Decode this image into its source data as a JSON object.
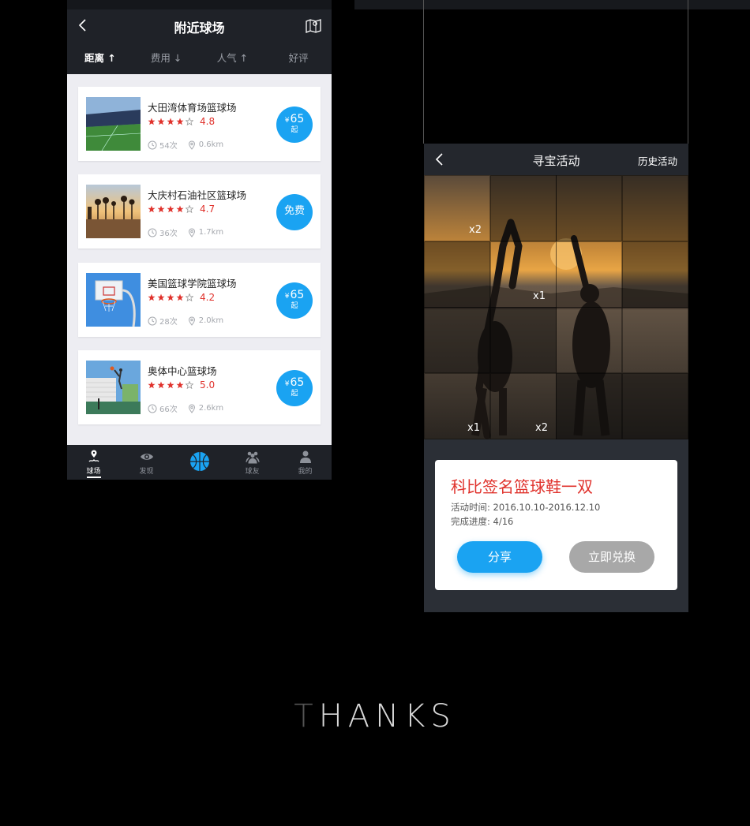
{
  "left_screen": {
    "title": "附近球场",
    "sort_tabs": [
      {
        "label": "距离 ↑",
        "active": true
      },
      {
        "label": "费用 ↓",
        "active": false
      },
      {
        "label": "人气 ↑",
        "active": false
      },
      {
        "label": "好评",
        "active": false
      }
    ],
    "courts": [
      {
        "name": "大田湾体育场篮球场",
        "score": "4.8",
        "stars": 4,
        "visits": "54次",
        "distance": "0.6km",
        "price_prefix": "¥",
        "price": "65",
        "price_suffix": "起",
        "free": false
      },
      {
        "name": "大庆村石油社区篮球场",
        "score": "4.7",
        "stars": 4,
        "visits": "36次",
        "distance": "1.7km",
        "price_label": "免费",
        "free": true
      },
      {
        "name": "美国篮球学院篮球场",
        "score": "4.2",
        "stars": 4,
        "visits": "28次",
        "distance": "2.0km",
        "price_prefix": "¥",
        "price": "65",
        "price_suffix": "起",
        "free": false
      },
      {
        "name": "奥体中心篮球场",
        "score": "5.0",
        "stars": 4,
        "visits": "66次",
        "distance": "2.6km",
        "price_prefix": "¥",
        "price": "65",
        "price_suffix": "起",
        "free": false
      }
    ],
    "tabbar": [
      {
        "label": "球场",
        "icon": "court-pin-icon",
        "active": true
      },
      {
        "label": "发现",
        "icon": "eye-icon",
        "active": false
      },
      {
        "label": "",
        "icon": "basketball-icon",
        "active": false
      },
      {
        "label": "球友",
        "icon": "friends-icon",
        "active": false
      },
      {
        "label": "我的",
        "icon": "person-icon",
        "active": false
      }
    ]
  },
  "right_screen": {
    "title": "寻宝活动",
    "history_label": "历史活动",
    "grid_multipliers": [
      {
        "cell": 0,
        "label": "x2"
      },
      {
        "cell": 6,
        "label": "x1"
      },
      {
        "cell": 12,
        "label": "x1"
      },
      {
        "cell": 13,
        "label": "x2"
      }
    ],
    "prize": {
      "title": "科比签名篮球鞋一双",
      "time_label": "活动时间:",
      "time_value": "2016.10.10-2016.12.10",
      "progress_label": "完成进度:",
      "progress_value": "4/16",
      "share_label": "分享",
      "redeem_label": "立即兑换"
    }
  },
  "footer": {
    "thanks_first": "T",
    "thanks_rest": "HANKS"
  },
  "colors": {
    "accent_blue": "#1aa3f2",
    "rating_red": "#e0322c",
    "nav_dark": "#1f2228"
  }
}
